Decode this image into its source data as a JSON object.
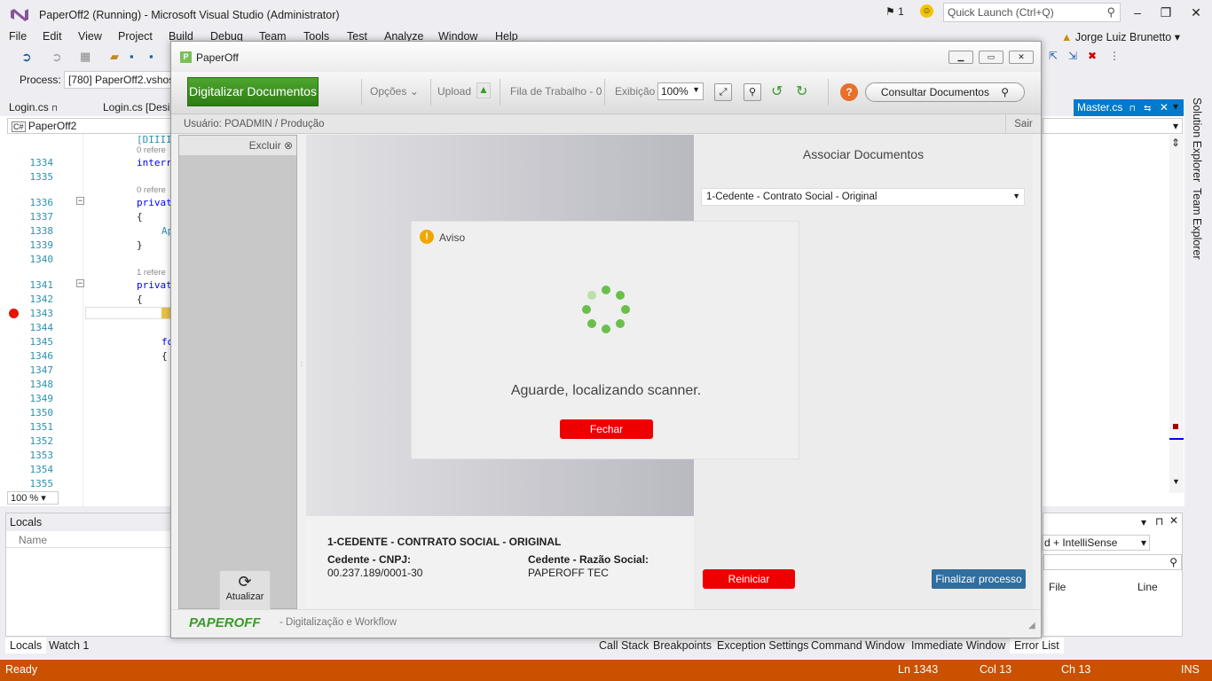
{
  "vs": {
    "title": "PaperOff2 (Running) - Microsoft Visual Studio (Administrator)",
    "notification_count": "1",
    "quick_launch_placeholder": "Quick Launch (Ctrl+Q)",
    "user": "Jorge Luiz Brunetto",
    "menu": [
      "File",
      "Edit",
      "View",
      "Project",
      "Build",
      "Debug",
      "Team",
      "Tools",
      "Test",
      "Analyze",
      "Window",
      "Help"
    ],
    "process_label": "Process:",
    "process_value": "[780] PaperOff2.vshos",
    "tabs": {
      "login_cs": "Login.cs",
      "login_designer": "Login.cs [Desi",
      "master_cs": "Master.cs"
    },
    "nav_class": "PaperOff2",
    "zoom": "100 %",
    "lines": [
      "1334",
      "1335",
      "1336",
      "1337",
      "1338",
      "1339",
      "1340",
      "1341",
      "1342",
      "1343",
      "1344",
      "1345",
      "1346",
      "1347",
      "1348",
      "1349",
      "1350",
      "1351",
      "1352",
      "1353",
      "1354",
      "1355"
    ],
    "code": {
      "l1333": "[DIIII",
      "l1334": "interr",
      "l1336": "privat",
      "l1337": "{",
      "l1338": "Ap",
      "l1339": "}",
      "l1341": "privat",
      "l1342": "{",
      "l1345": "fo",
      "l1346": "{"
    },
    "ref_labels": [
      "0 refere",
      "0 refere",
      "1 refere"
    ],
    "locals": {
      "title": "Locals",
      "column": "Name"
    },
    "bottom_left_tabs": [
      "Locals",
      "Watch 1"
    ],
    "bottom_right_tabs": [
      "Call Stack",
      "Breakpoints",
      "Exception Settings",
      "Command Window",
      "Immediate Window",
      "Error List"
    ],
    "error_list": {
      "filter": "d + IntelliSense",
      "col_file": "File",
      "col_line": "Line"
    },
    "side_tabs": [
      "Solution Explorer",
      "Team Explorer"
    ],
    "status": {
      "state": "Ready",
      "ln": "Ln 1343",
      "col": "Col 13",
      "ch": "Ch 13",
      "mode": "INS"
    }
  },
  "paperoff": {
    "title": "PaperOff",
    "toolbar": {
      "digitalizar": "Digitalizar Documentos",
      "opcoes": "Opções",
      "upload": "Upload",
      "fila": "Fila de Trabalho - 0",
      "exibicao": "Exibição",
      "zoom": "100%",
      "consultar": "Consultar Documentos"
    },
    "user_line": "Usuário: POADMIN / Produção",
    "sair": "Sair",
    "excluir": "Excluir",
    "atualizar": "Atualizar",
    "associar_title": "Associar Documentos",
    "doc_type": "1-Cedente - Contrato Social - Original",
    "doc_info": {
      "heading": "1-CEDENTE - CONTRATO SOCIAL - ORIGINAL",
      "cnpj_label": "Cedente - CNPJ:",
      "cnpj_value": "00.237.189/0001-30",
      "razao_label": "Cedente - Razão Social:",
      "razao_value": "PAPEROFF TEC"
    },
    "reiniciar": "Reiniciar",
    "finalizar": "Finalizar processo",
    "footer_brand": "PAPEROFF",
    "footer_tag": "- Digitalização e Workflow"
  },
  "aviso": {
    "title": "Aviso",
    "message": "Aguarde, localizando scanner.",
    "fechar": "Fechar"
  },
  "colors": {
    "accent": "#007acc",
    "status": "#ca5100",
    "green": "#2d7c15",
    "red": "#ee0000",
    "blue_btn": "#2f6e9e"
  }
}
